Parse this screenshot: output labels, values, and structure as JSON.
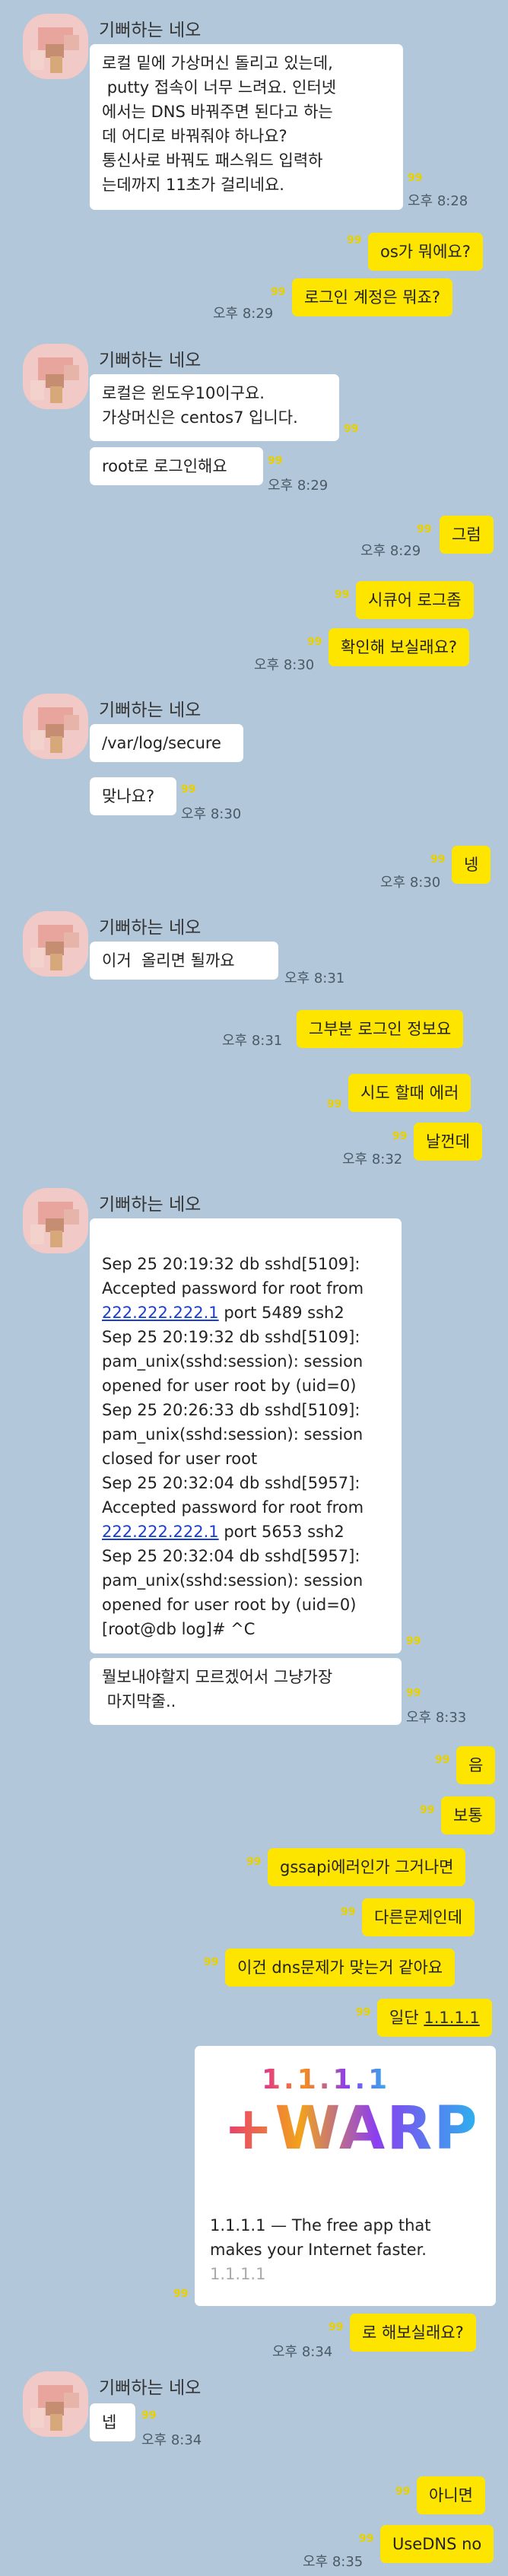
{
  "sender_name": "기뻐하는 네오",
  "read_mark": "99",
  "messages": {
    "m1": "로컬 밑에 가상머신 돌리고 있는데,\n putty 접속이 너무 느려요. 인터넷\n에서는 DNS 바꿔주면 된다고 하는\n데 어디로 바꿔줘야 하나요?\n통신사로 바꿔도 패스워드 입력하\n는데까지 11초가 걸리네요.",
    "t1": "오후 8:28",
    "m2": "os가 뭐에요?",
    "m3": "로그인 계정은 뭐죠?",
    "t3": "오후 8:29",
    "m4": "로컬은 윈도우10이구요.\n가상머신은 centos7 입니다.",
    "m5": "root로 로그인해요",
    "t5": "오후 8:29",
    "m6": "그럼",
    "t6": "오후 8:29",
    "m7": "시큐어 로그좀",
    "m8": "확인해 보실래요?",
    "t8": "오후 8:30",
    "m9": "/var/log/secure",
    "m10": "맞나요?",
    "t10": "오후 8:30",
    "m11": "넹",
    "t11": "오후 8:30",
    "m12": "이거  올리면 될까요",
    "t12": "오후 8:31",
    "m13": "그부분 로그인 정보요",
    "t13": "오후 8:31",
    "m14": "시도 할때 에러",
    "m15": "날껀데",
    "t15": "오후 8:32",
    "log": {
      "l1": "Sep 25 20:19:32 db sshd[5109]:",
      "l2": "Accepted password for root from",
      "ip1": "222.222.222.1",
      "l3": " port 5489 ssh2",
      "l4": "Sep 25 20:19:32 db sshd[5109]:",
      "l5": "pam_unix(sshd:session): session",
      "l6": "opened for user root by (uid=0)",
      "l7": "Sep 25 20:26:33 db sshd[5109]:",
      "l8": "pam_unix(sshd:session): session",
      "l9": "closed for user root",
      "l10": "Sep 25 20:32:04 db sshd[5957]:",
      "l11": "Accepted password for root from",
      "ip2": "222.222.222.1",
      "l12": " port 5653 ssh2",
      "l13": "Sep 25 20:32:04 db sshd[5957]:",
      "l14": "pam_unix(sshd:session): session",
      "l15": "opened for user root by (uid=0)",
      "l16": "[root@db log]# ^C"
    },
    "m16": "뭘보내야할지 모르겠어서 그냥가장\n 마지막줄..",
    "t16": "오후 8:33",
    "m17": "음",
    "m18": "보통",
    "m19": "gssapi에러인가 그거나면",
    "m20": "다른문제인데",
    "m21": "이건 dns문제가 맞는거 같아요",
    "m22_prefix": "일단 ",
    "m22_link": "1.1.1.1",
    "card": {
      "title_small": "1.1.1.1",
      "title_big": "+WARP",
      "desc": "1.1.1.1 — The free app that\nmakes your Internet faster.",
      "domain": "1.1.1.1"
    },
    "m23": "로 해보실래요?",
    "t23": "오후 8:34",
    "m24": "넵",
    "t24": "오후 8:34",
    "m25": "아니면",
    "m26": "UseDNS no",
    "t26": "오후 8:35"
  }
}
